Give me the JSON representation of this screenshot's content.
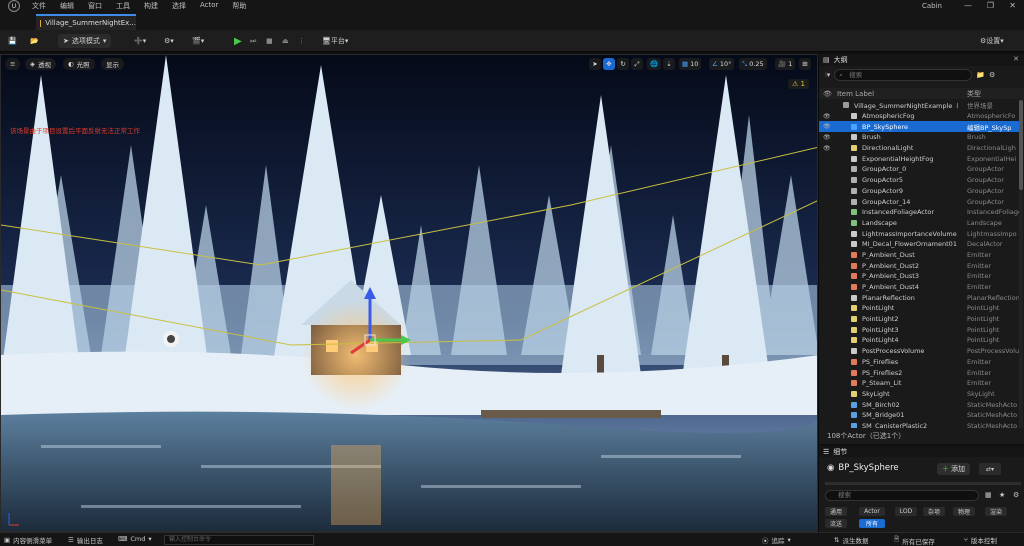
{
  "menubar": {
    "logo": "U",
    "items": [
      "文件",
      "编辑",
      "窗口",
      "工具",
      "构建",
      "选择",
      "Actor",
      "帮助"
    ],
    "project": "Cabin",
    "controls": [
      "—",
      "❐",
      "✕"
    ]
  },
  "tab": {
    "label": "Village_SummerNightEx..."
  },
  "toolbar": {
    "mode_label": "选项模式",
    "platform_label": "平台",
    "settings_label": "设置"
  },
  "viewport": {
    "buttons": [
      "透视",
      "光照",
      "显示"
    ],
    "snap_grid": "10",
    "snap_angle": "10°",
    "snap_scale": "0.25",
    "camera_speed": "1",
    "warning": "⚠ 1",
    "message": "该场景由于项目设置后平面反射无法正常工作"
  },
  "outliner": {
    "title": "大纲",
    "search_placeholder": "搜索",
    "col_label": "Item Label",
    "col_type": "类型",
    "rows": [
      {
        "name": "Village_SummerNightExample（编",
        "type": "世界场景",
        "color": "#9a9a9a",
        "eye": "",
        "root": true
      },
      {
        "name": "AtmosphericFog",
        "type": "AtmosphericFo",
        "color": "#c9c9c9",
        "eye": "👁"
      },
      {
        "name": "BP_SkySphere",
        "type": "编辑BP_SkySp",
        "color": "#4aa3ff",
        "eye": "👁",
        "selected": true
      },
      {
        "name": "Brush",
        "type": "Brush",
        "color": "#c9c9c9",
        "eye": "👁"
      },
      {
        "name": "DirectionalLight",
        "type": "DirectionalLigh",
        "color": "#e0d070",
        "eye": "👁"
      },
      {
        "name": "ExponentialHeightFog",
        "type": "ExponentialHei",
        "color": "#c9c9c9",
        "eye": ""
      },
      {
        "name": "GroupActor_0",
        "type": "GroupActor",
        "color": "#b0b0b0",
        "eye": ""
      },
      {
        "name": "GroupActor5",
        "type": "GroupActor",
        "color": "#b0b0b0",
        "eye": ""
      },
      {
        "name": "GroupActor9",
        "type": "GroupActor",
        "color": "#b0b0b0",
        "eye": ""
      },
      {
        "name": "GroupActor_14",
        "type": "GroupActor",
        "color": "#b0b0b0",
        "eye": ""
      },
      {
        "name": "InstancedFoliageActor",
        "type": "InstancedFoliageA",
        "color": "#7fc07f",
        "eye": ""
      },
      {
        "name": "Landscape",
        "type": "Landscape",
        "color": "#7fc07f",
        "eye": ""
      },
      {
        "name": "LightmassImportanceVolume",
        "type": "LightmassImpo",
        "color": "#c9c9c9",
        "eye": ""
      },
      {
        "name": "MI_Decal_FlowerOrnament01",
        "type": "DecalActor",
        "color": "#c9c9c9",
        "eye": ""
      },
      {
        "name": "P_Ambient_Dust",
        "type": "Emitter",
        "color": "#e07a5a",
        "eye": ""
      },
      {
        "name": "P_Ambient_Dust2",
        "type": "Emitter",
        "color": "#e07a5a",
        "eye": ""
      },
      {
        "name": "P_Ambient_Dust3",
        "type": "Emitter",
        "color": "#e07a5a",
        "eye": ""
      },
      {
        "name": "P_Ambient_Dust4",
        "type": "Emitter",
        "color": "#e07a5a",
        "eye": ""
      },
      {
        "name": "PlanarReflection",
        "type": "PlanarReflection",
        "color": "#c9c9c9",
        "eye": ""
      },
      {
        "name": "PointLight",
        "type": "PointLight",
        "color": "#e0d070",
        "eye": ""
      },
      {
        "name": "PointLight2",
        "type": "PointLight",
        "color": "#e0d070",
        "eye": ""
      },
      {
        "name": "PointLight3",
        "type": "PointLight",
        "color": "#e0d070",
        "eye": ""
      },
      {
        "name": "PointLight4",
        "type": "PointLight",
        "color": "#e0d070",
        "eye": ""
      },
      {
        "name": "PostProcessVolume",
        "type": "PostProcessVolu",
        "color": "#c9c9c9",
        "eye": ""
      },
      {
        "name": "PS_Fireflies",
        "type": "Emitter",
        "color": "#e07a5a",
        "eye": ""
      },
      {
        "name": "PS_Fireflies2",
        "type": "Emitter",
        "color": "#e07a5a",
        "eye": ""
      },
      {
        "name": "P_Steam_Lit",
        "type": "Emitter",
        "color": "#e07a5a",
        "eye": ""
      },
      {
        "name": "SkyLight",
        "type": "SkyLight",
        "color": "#e0d070",
        "eye": ""
      },
      {
        "name": "SM_Birch02",
        "type": "StaticMeshActo",
        "color": "#5aa0e0",
        "eye": ""
      },
      {
        "name": "SM_Bridge01",
        "type": "StaticMeshActo",
        "color": "#5aa0e0",
        "eye": ""
      },
      {
        "name": "SM_CanisterPlastic2",
        "type": "StaticMeshActo",
        "color": "#5aa0e0",
        "eye": ""
      }
    ],
    "footer": "108个Actor（已选1个）"
  },
  "details": {
    "title": "细节",
    "actor_name": "BP_SkySphere",
    "add_label": "添加",
    "search_placeholder": "搜索",
    "filters": [
      "通用",
      "Actor",
      "LOD",
      "杂项",
      "物理",
      "渲染",
      "流送",
      "所有"
    ]
  },
  "statusbar": {
    "content_drawer": "内容侧滑菜单",
    "output_log": "输出日志",
    "cmd": "Cmd",
    "cmd_placeholder": "输入控制台命令",
    "trace": "追踪",
    "derived_data": "派生数据",
    "saved": "所有已保存",
    "source_control": "版本控制"
  },
  "colors": {
    "accent": "#1a6bd1",
    "play": "#4cc94c",
    "warning": "#e8c23a",
    "error_text": "#e23a2a"
  }
}
